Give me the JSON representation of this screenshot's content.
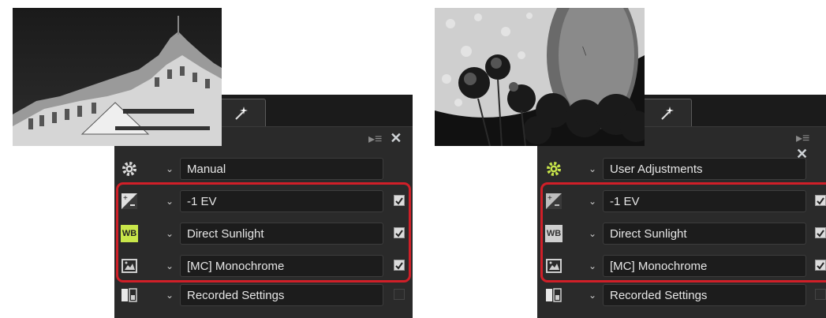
{
  "left_panel": {
    "rows": [
      {
        "name": "picture-control-mode",
        "icon": "gear-icon",
        "value": "Manual",
        "checkbox": null
      },
      {
        "name": "exposure-compensation",
        "icon": "exposure-compensation-icon",
        "value": "-1 EV",
        "checkbox": true
      },
      {
        "name": "white-balance",
        "icon": "white-balance-icon",
        "icon_label": "WB",
        "value": "Direct Sunlight",
        "checkbox": true
      },
      {
        "name": "picture-control",
        "icon": "picture-control-icon",
        "value": "[MC] Monochrome",
        "checkbox": true
      },
      {
        "name": "active-d-lighting",
        "icon": "recorded-settings-icon",
        "value": "Recorded Settings",
        "checkbox": false
      }
    ],
    "accent": "#c8e64a"
  },
  "right_panel": {
    "rows": [
      {
        "name": "picture-control-mode",
        "icon": "gear-icon",
        "value": "User Adjustments",
        "checkbox": null
      },
      {
        "name": "exposure-compensation",
        "icon": "exposure-compensation-icon",
        "value": "-1 EV",
        "checkbox": true
      },
      {
        "name": "white-balance",
        "icon": "white-balance-icon",
        "icon_label": "WB",
        "value": "Direct Sunlight",
        "checkbox": true
      },
      {
        "name": "picture-control",
        "icon": "picture-control-icon",
        "value": "[MC] Monochrome",
        "checkbox": true
      },
      {
        "name": "active-d-lighting",
        "icon": "recorded-settings-icon",
        "value": "Recorded Settings",
        "checkbox": false
      }
    ],
    "accent": "#c8e64a"
  },
  "colors": {
    "highlight": "#d01f28",
    "panel": "#2a2a2a",
    "field": "#1c1c1c"
  }
}
